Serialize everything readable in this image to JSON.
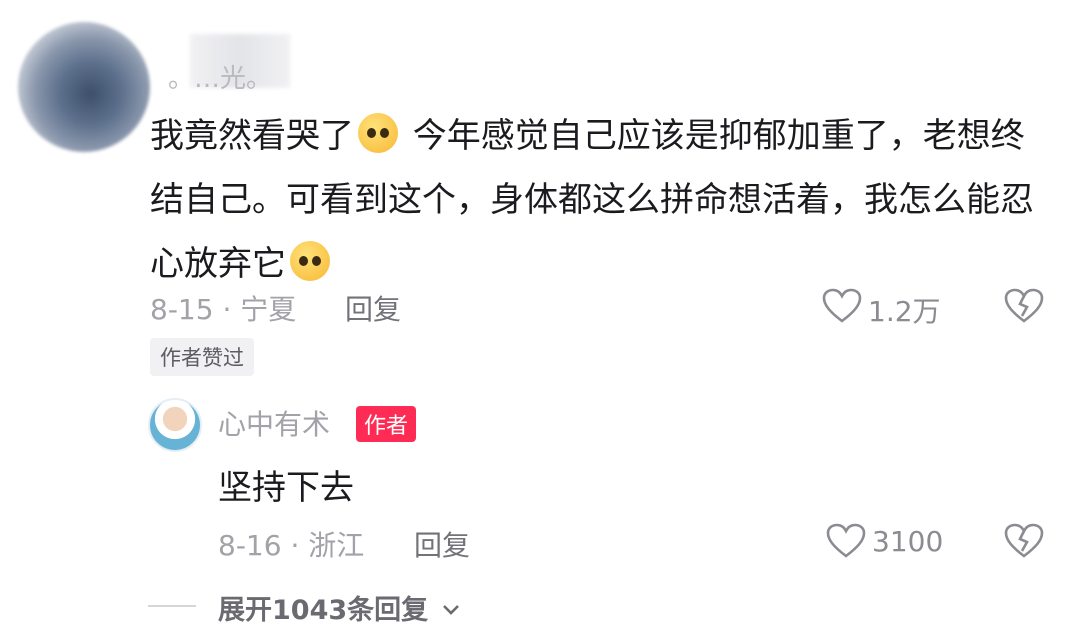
{
  "main_comment": {
    "username": "。…光。",
    "text_before_emoji": "我竟然看哭了",
    "emoji1": "crying-emoji",
    "text_after_emoji": " 今年感觉自己应该是抑郁加重了，老想终结自己。可看到这个，身体都这么拼命想活着，我怎么能忍心放弃它",
    "emoji2": "pleading-emoji",
    "date_location": "8-15 · 宁夏",
    "reply_label": "回复",
    "likes": "1.2万",
    "liked_by_author_label": "作者赞过"
  },
  "reply_comment": {
    "username": "心中有术",
    "author_badge": "作者",
    "text": "坚持下去",
    "date_location": "8-16 · 浙江",
    "reply_label": "回复",
    "likes": "3100"
  },
  "expand_label": "展开1043条回复",
  "colors": {
    "author_badge_bg": "#fe2c55",
    "text_primary": "#1b1b1f",
    "text_secondary": "#a2a2a8"
  }
}
